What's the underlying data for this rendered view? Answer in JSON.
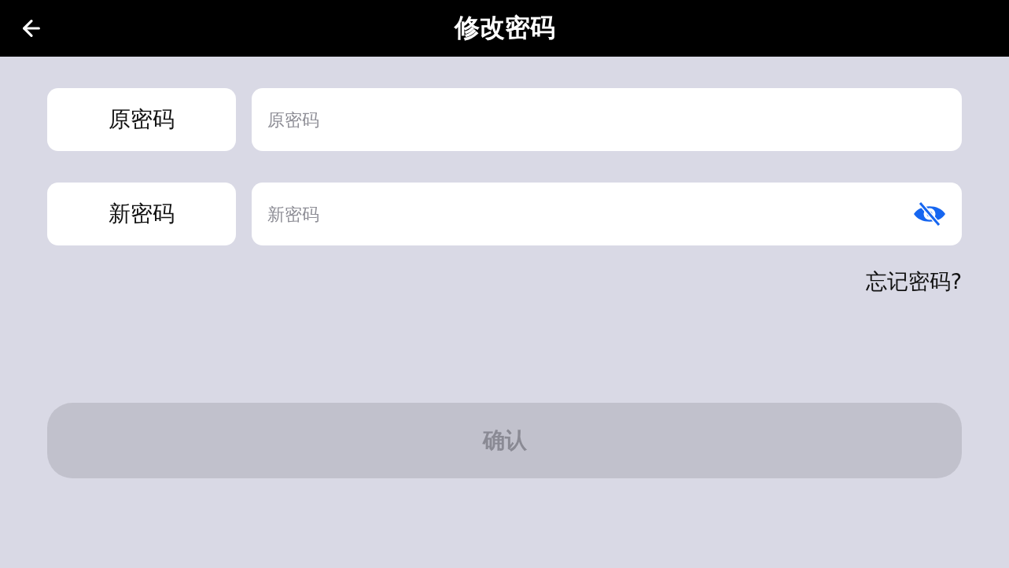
{
  "header": {
    "title": "修改密码"
  },
  "fields": [
    {
      "label": "原密码",
      "placeholder": "原密码"
    },
    {
      "label": "新密码",
      "placeholder": "新密码",
      "visibility_toggle": {
        "visible": false
      }
    }
  ],
  "forgot_link": "忘记密码?",
  "confirm_button": {
    "label": "确认",
    "disabled": true
  }
}
